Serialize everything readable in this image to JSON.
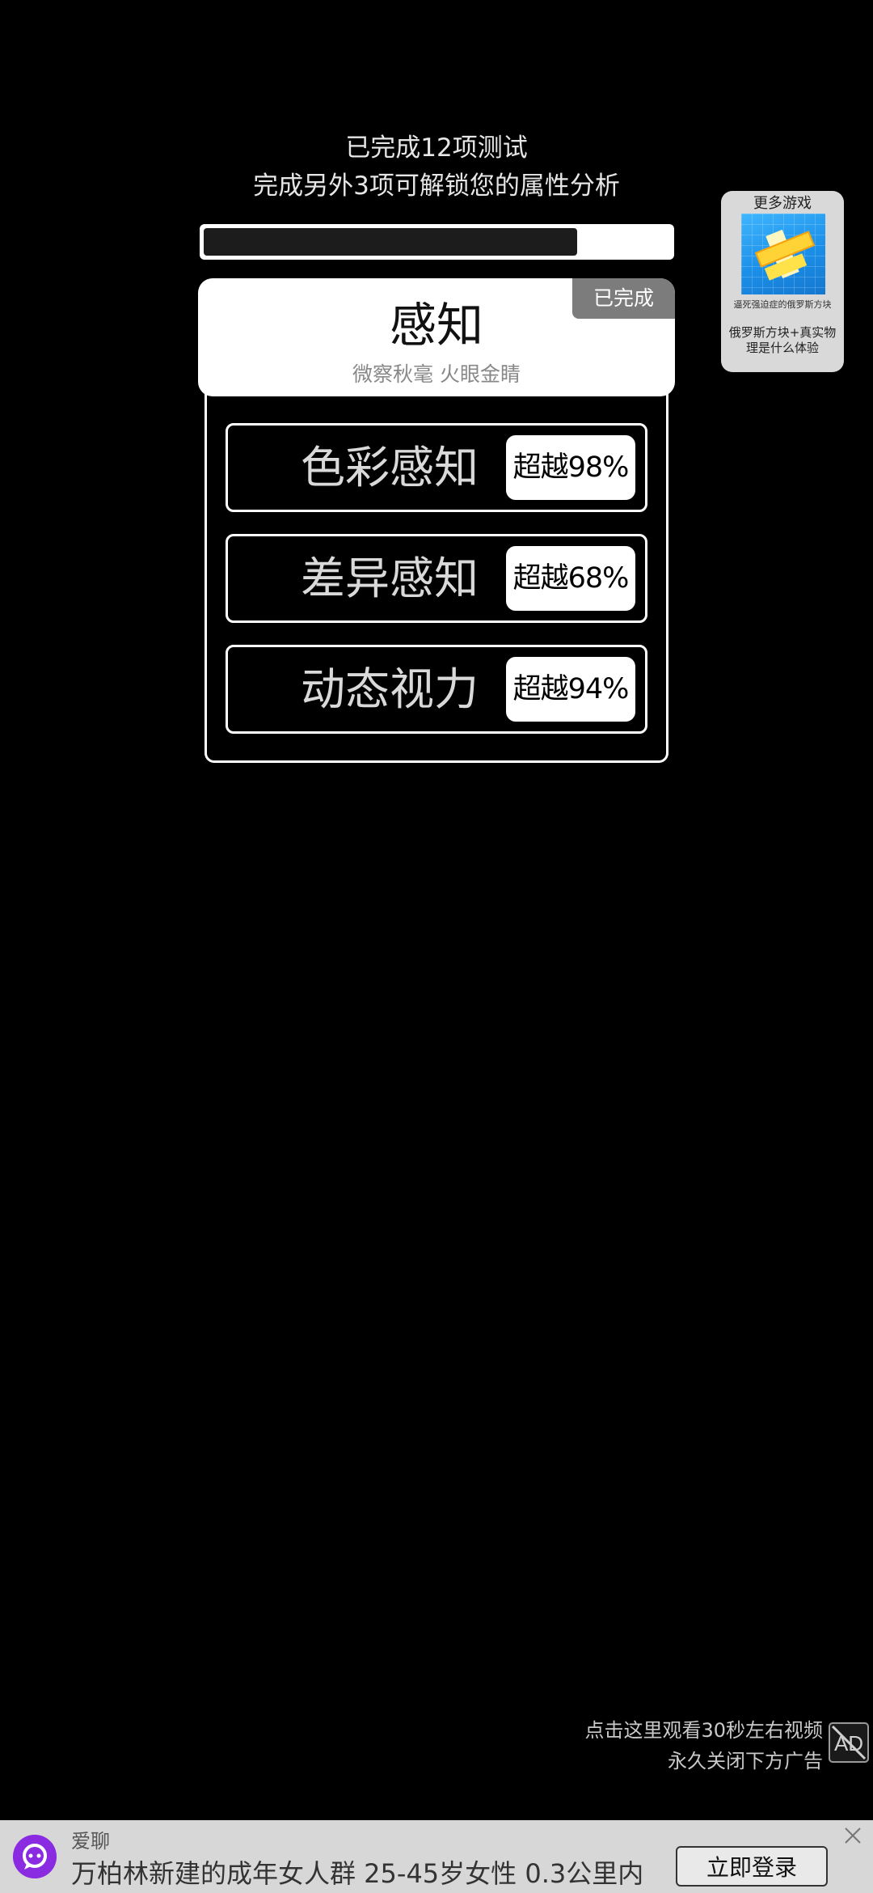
{
  "header": {
    "completed_line": "已完成12项测试",
    "unlock_line": "完成另外3项可解锁您的属性分析",
    "progress": 0.8
  },
  "category": {
    "title": "感知",
    "subtitle": "微察秋毫 火眼金睛",
    "badge": "已完成"
  },
  "tests": [
    {
      "name": "色彩感知",
      "score": "超越98%"
    },
    {
      "name": "差异感知",
      "score": "超越68%"
    },
    {
      "name": "动态视力",
      "score": "超越94%"
    }
  ],
  "more_games": {
    "title": "更多游戏",
    "caption": "逼死强迫症的俄罗斯方块",
    "description": "俄罗斯方块+真实物理是什么体验"
  },
  "video_notice": {
    "line1": "点击这里观看30秒左右视频",
    "line2": "永久关闭下方广告"
  },
  "ad_banner": {
    "brand": "爱聊",
    "text": "万柏林新建的成年女人群 25-45岁女性 0.3公里内",
    "button": "立即登录"
  },
  "colors": {
    "background": "#000000",
    "card": "#ffffff",
    "badge": "#7c7c7c",
    "ad_logo": "#8a2be2"
  }
}
